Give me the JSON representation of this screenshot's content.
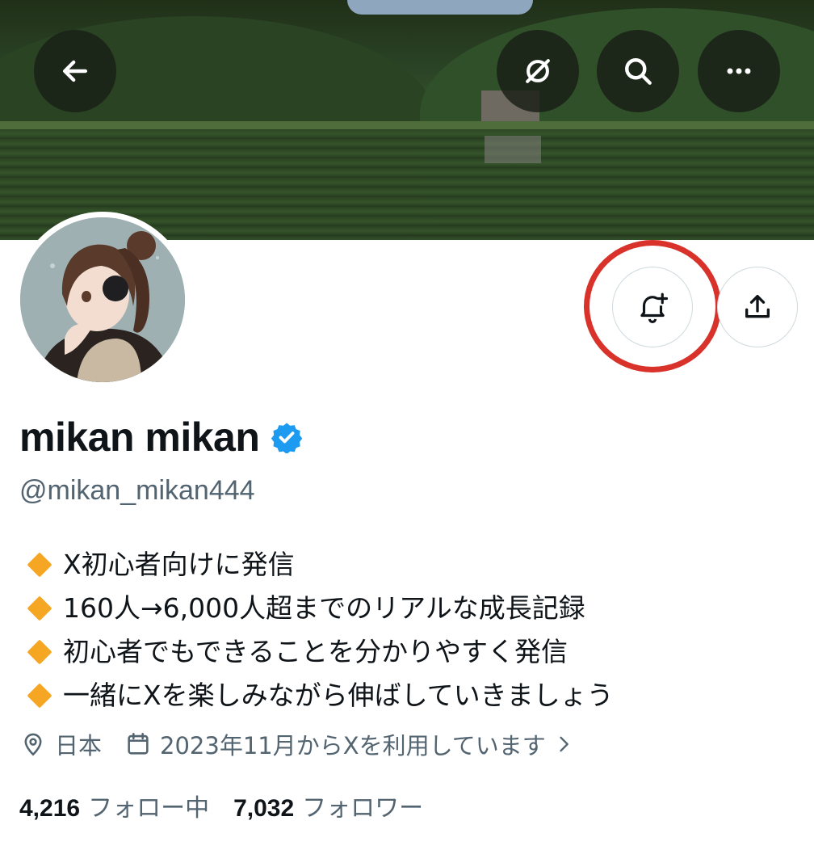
{
  "header": {
    "back_icon": "arrow-left-icon",
    "grok_icon": "grok-icon",
    "search_icon": "search-icon",
    "more_icon": "more-horizontal-icon"
  },
  "profile": {
    "display_name": "mikan mikan",
    "verified": true,
    "handle": "@mikan_mikan444",
    "bio": [
      "X初心者向けに発信",
      "160人→6,000人超までのリアルな成長記録",
      "初心者でもできることを分かりやすく発信",
      "一緒にXを楽しみながら伸ばしていきましょう"
    ],
    "location": "日本",
    "joined": "2023年11月からXを利用しています",
    "following_count": "4,216",
    "following_label": "フォロー中",
    "followers_count": "7,032",
    "followers_label": "フォロワー"
  },
  "actions": {
    "notify_icon": "bell-plus-icon",
    "share_icon": "share-icon"
  },
  "colors": {
    "highlight_ring": "#d8322b",
    "verified_badge": "#1d9bf0",
    "bio_bullet": "#f5a623",
    "secondary_text": "#536471"
  }
}
